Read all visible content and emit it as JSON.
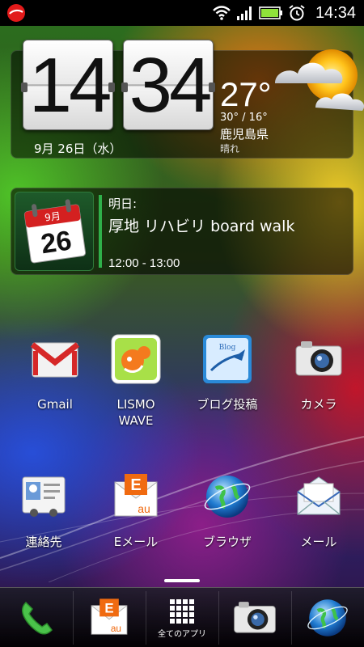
{
  "status_bar": {
    "time": "14:34",
    "icons": [
      "security-app-icon",
      "wifi-icon",
      "signal-icon",
      "battery-icon",
      "alarm-icon"
    ]
  },
  "clock_widget": {
    "hours": "14",
    "minutes": "34",
    "date": "9月 26日（水）",
    "temperature": "27°",
    "high_low": "30° / 16°",
    "city": "鹿児島県",
    "condition": "晴れ",
    "weather_icon": "sunny-cloudy-icon"
  },
  "calendar_widget": {
    "icon_month": "9月",
    "icon_day": "26",
    "when": "明日:",
    "title": "厚地 リハビリ board walk",
    "time": "12:00 - 13:00",
    "accent_color": "#2fb04a"
  },
  "apps": [
    {
      "label": "Gmail",
      "icon": "gmail-icon"
    },
    {
      "label": "LISMO\nWAVE",
      "icon": "lismo-wave-icon"
    },
    {
      "label": "ブログ投稿",
      "icon": "blog-icon"
    },
    {
      "label": "カメラ",
      "icon": "camera-icon"
    },
    {
      "label": "連絡先",
      "icon": "contacts-icon"
    },
    {
      "label": "Eメール",
      "icon": "email-icon"
    },
    {
      "label": "ブラウザ",
      "icon": "browser-icon"
    },
    {
      "label": "メール",
      "icon": "mail-icon"
    }
  ],
  "dock": {
    "all_apps_label": "全てのアプリ",
    "items": [
      "phone-icon",
      "email-icon",
      "all-apps-icon",
      "camera-icon",
      "browser-icon"
    ]
  }
}
